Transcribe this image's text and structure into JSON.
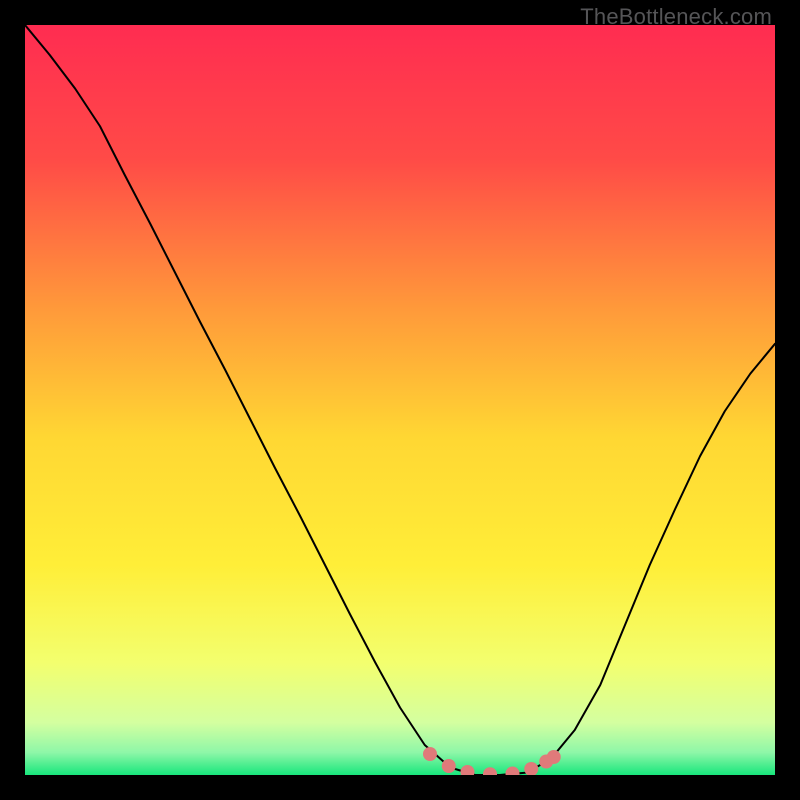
{
  "watermark": "TheBottleneck.com",
  "chart_data": {
    "type": "line",
    "title": "",
    "xlabel": "",
    "ylabel": "",
    "xlim": [
      0,
      100
    ],
    "ylim": [
      0,
      100
    ],
    "background_gradient": {
      "top": "#ff2c51",
      "upper_mid": "#ff8f3a",
      "mid": "#ffe634",
      "lower_mid": "#f5ff70",
      "bottom": "#18e67c"
    },
    "series": [
      {
        "name": "bottleneck-curve",
        "color": "#000000",
        "x": [
          0.0,
          3.3,
          6.7,
          10.0,
          13.3,
          16.7,
          20.0,
          23.3,
          26.7,
          30.0,
          33.3,
          36.7,
          40.0,
          43.3,
          46.7,
          50.0,
          53.3,
          56.7,
          60.0,
          63.3,
          66.7,
          70.0,
          73.3,
          76.7,
          80.0,
          83.3,
          86.7,
          90.0,
          93.3,
          96.7,
          100.0
        ],
        "y": [
          100.0,
          96.0,
          91.5,
          86.5,
          80.0,
          73.5,
          67.0,
          60.5,
          54.0,
          47.5,
          41.0,
          34.5,
          28.0,
          21.5,
          15.0,
          9.0,
          4.0,
          1.0,
          0.0,
          0.0,
          0.3,
          2.0,
          6.0,
          12.0,
          20.0,
          28.0,
          35.5,
          42.5,
          48.5,
          53.5,
          57.5
        ]
      },
      {
        "name": "marker-dots",
        "color": "#e07a7a",
        "x": [
          54.0,
          56.5,
          59.0,
          62.0,
          65.0,
          67.5,
          69.5,
          70.5
        ],
        "y": [
          2.8,
          1.2,
          0.4,
          0.1,
          0.2,
          0.8,
          1.8,
          2.4
        ]
      }
    ]
  }
}
